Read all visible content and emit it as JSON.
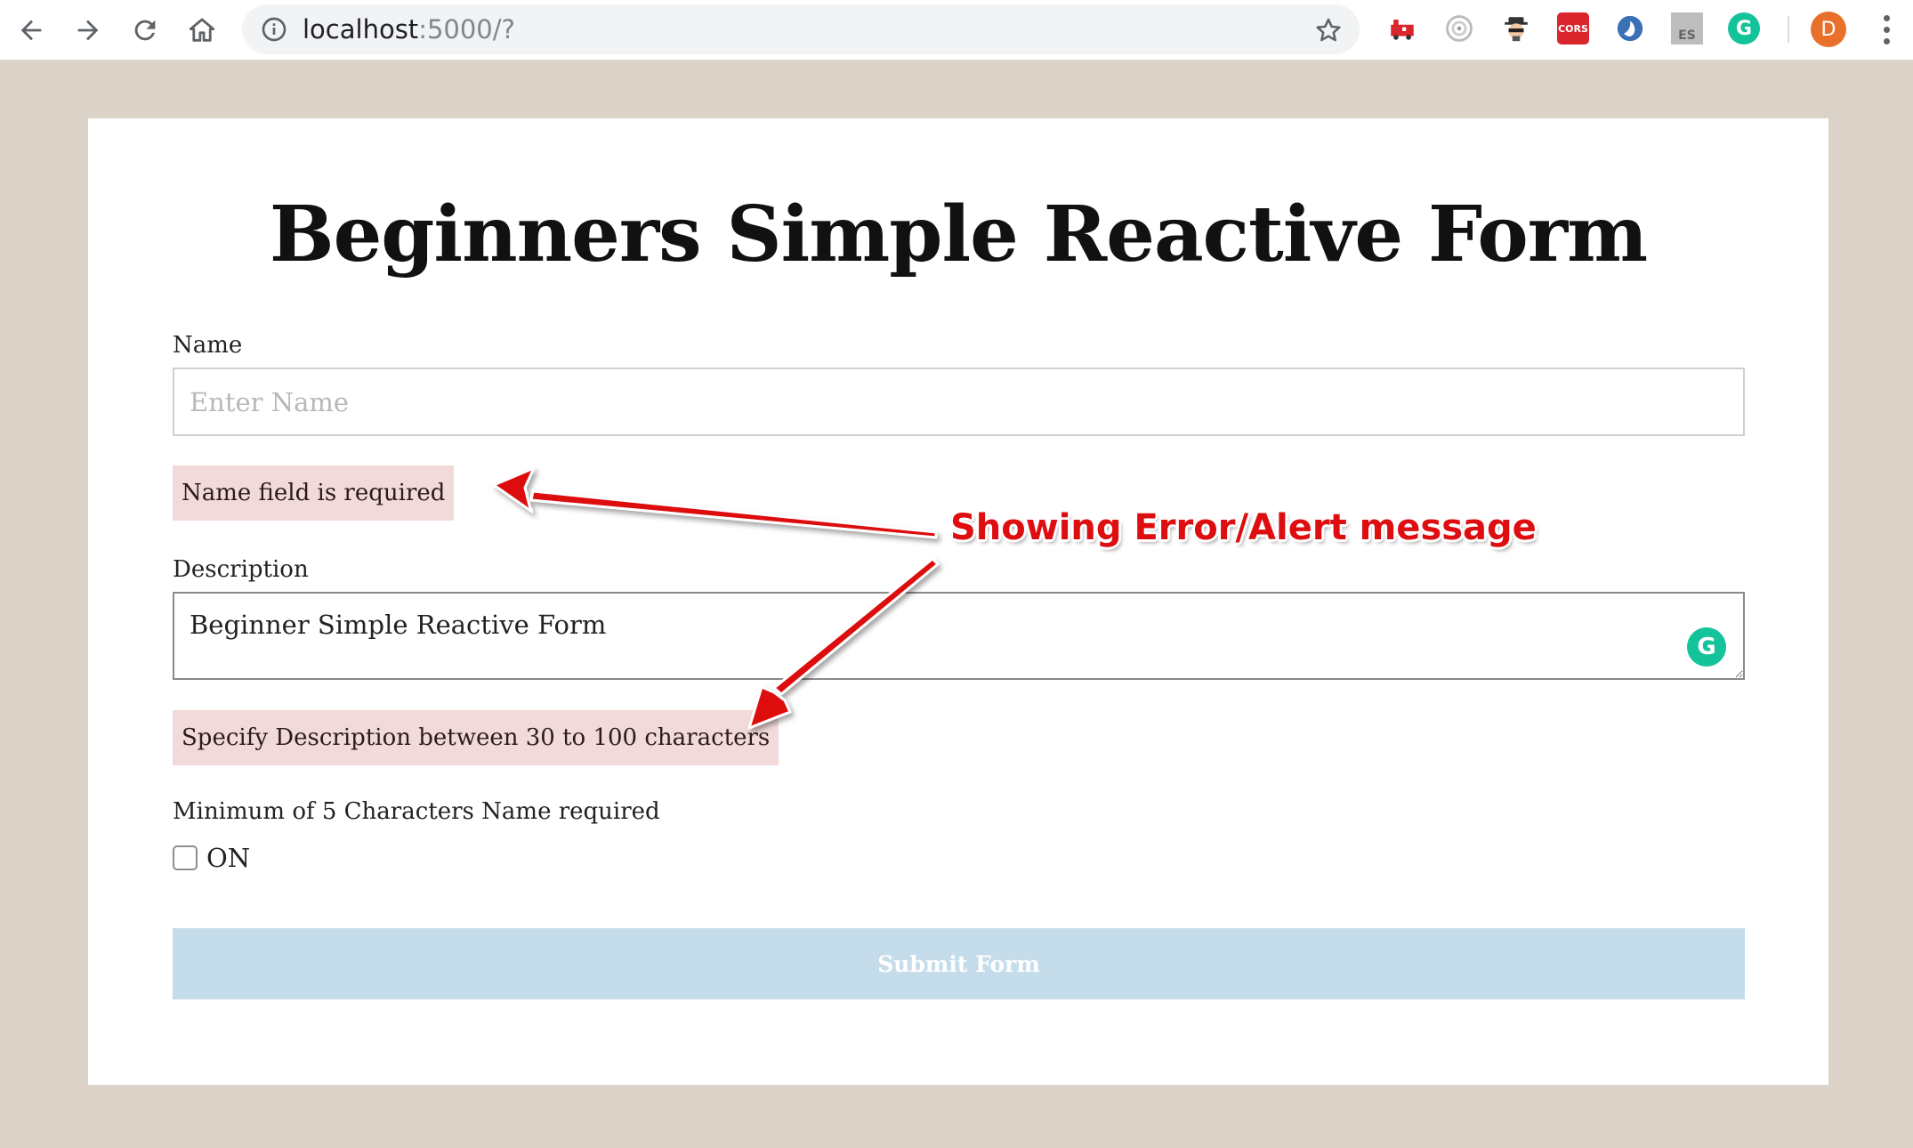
{
  "browser": {
    "url_host": "localhost",
    "url_rest": ":5000/?",
    "extensions": [
      {
        "name": "train-extension-icon"
      },
      {
        "name": "target-extension-icon"
      },
      {
        "name": "spy-extension-icon"
      },
      {
        "name": "cors-extension-icon",
        "label": "CORS"
      },
      {
        "name": "swirl-extension-icon"
      },
      {
        "name": "es-extension-icon",
        "label": "ES"
      },
      {
        "name": "grammarly-extension-icon",
        "label": "G"
      }
    ],
    "avatar_initial": "D"
  },
  "page": {
    "title": "Beginners Simple Reactive Form",
    "name_label": "Name",
    "name_placeholder": "Enter Name",
    "name_error": "Name field is required",
    "description_label": "Description",
    "description_value": "Beginner Simple Reactive Form",
    "description_error": "Specify Description between 30 to 100 characters",
    "checkbox_heading": "Minimum of 5 Characters Name required",
    "checkbox_label": "ON",
    "submit_label": "Submit Form",
    "grammarly_badge": "G"
  },
  "annotation": {
    "text": "Showing Error/Alert message",
    "color": "#dd0d10"
  },
  "colors": {
    "page_background": "#dbd3c7",
    "alert_background": "#f3dada",
    "submit_disabled": "#c5dcea",
    "grammarly": "#15c39a"
  }
}
